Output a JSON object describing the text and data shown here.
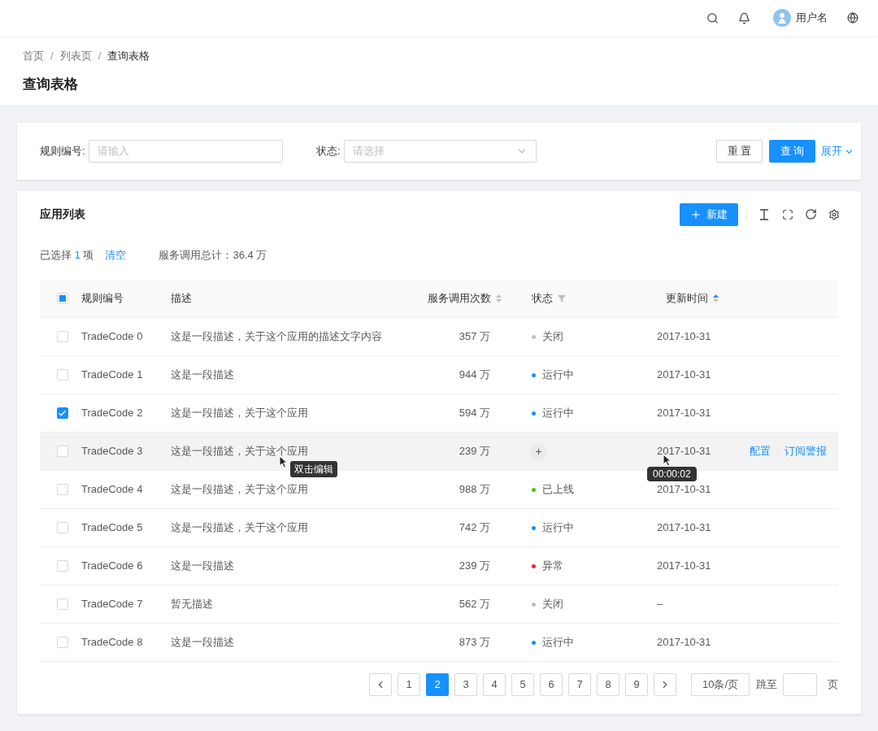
{
  "top_bar": {
    "user_name": "用户名"
  },
  "breadcrumb": [
    {
      "label": "首页",
      "current": false
    },
    {
      "separator": "/",
      "label": "列表页",
      "current": false
    },
    {
      "separator": "/",
      "label": "查询表格",
      "current": true
    }
  ],
  "page_title": "查询表格",
  "search_form": {
    "fields": [
      {
        "kind": "input",
        "label": "规则编号:",
        "placeholder": "请输入"
      },
      {
        "kind": "select",
        "label": "状态:",
        "placeholder": "请选择"
      }
    ],
    "reset_button": "重 置",
    "query_button": "查 询",
    "expand_link": "展开"
  },
  "table_card": {
    "title": "应用列表",
    "new_button": "新建",
    "selection_info": {
      "prefix": "已选择",
      "count": "1",
      "suffix": "项",
      "clear_link": "清空",
      "total": "服务调用总计：36.4 万"
    },
    "header_checkbox": {
      "indeterminate": true
    },
    "columns": [
      {
        "label": "规则编号",
        "kind": "plain"
      },
      {
        "label": "描述",
        "kind": "plain"
      },
      {
        "label": "服务调用次数",
        "kind": "sort"
      },
      {
        "label": "状态",
        "kind": "filter"
      },
      {
        "label": "更新时间",
        "kind": "sort_active"
      },
      {
        "kind": "actions"
      }
    ],
    "rows": [
      {
        "checked": false,
        "hovered": false,
        "code": "TradeCode 0",
        "description": "这是一段描述，关于这个应用的描述文字内容",
        "calls": "357 万",
        "status": {
          "label": "关闭",
          "color": "#bfbfbf"
        },
        "updated": "2017-10-31"
      },
      {
        "checked": false,
        "hovered": false,
        "code": "TradeCode 1",
        "description": "这是一段描述",
        "calls": "944 万",
        "status": {
          "label": "运行中",
          "color": "#1890ff"
        },
        "updated": "2017-10-31"
      },
      {
        "checked": true,
        "hovered": false,
        "code": "TradeCode 2",
        "description": "这是一段描述，关于这个应用",
        "calls": "594 万",
        "status": {
          "label": "运行中",
          "color": "#1890ff"
        },
        "updated": "2017-10-31"
      },
      {
        "checked": false,
        "hovered": true,
        "code": "TradeCode 3",
        "description": "这是一段描述，关于这个应用",
        "calls": "239 万",
        "status_add": "+",
        "updated": "2017-10-31",
        "actions": [
          "配置",
          "订阅警报"
        ],
        "description_tooltip": "双击编辑",
        "updated_tooltip": "00:00:02"
      },
      {
        "checked": false,
        "hovered": false,
        "code": "TradeCode 4",
        "description": "这是一段描述，关于这个应用",
        "calls": "988 万",
        "status": {
          "label": "已上线",
          "color": "#52c41a"
        },
        "updated": "2017-10-31"
      },
      {
        "checked": false,
        "hovered": false,
        "code": "TradeCode 5",
        "description": "这是一段描述，关于这个应用",
        "calls": "742 万",
        "status": {
          "label": "运行中",
          "color": "#1890ff"
        },
        "updated": "2017-10-31"
      },
      {
        "checked": false,
        "hovered": false,
        "code": "TradeCode 6",
        "description": "这是一段描述",
        "calls": "239 万",
        "status": {
          "label": "异常",
          "color": "#f5222d"
        },
        "updated": "2017-10-31"
      },
      {
        "checked": false,
        "hovered": false,
        "code": "TradeCode 7",
        "description": "暂无描述",
        "calls": "562 万",
        "status": {
          "label": "关闭",
          "color": "#bfbfbf"
        },
        "updated": "–"
      },
      {
        "checked": false,
        "hovered": false,
        "code": "TradeCode 8",
        "description": "这是一段描述",
        "calls": "873 万",
        "status": {
          "label": "运行中",
          "color": "#1890ff"
        },
        "updated": "2017-10-31"
      }
    ],
    "pagination": {
      "pages": [
        {
          "label": "1",
          "selected": false
        },
        {
          "label": "2",
          "selected": true
        },
        {
          "label": "3",
          "selected": false
        },
        {
          "label": "4",
          "selected": false
        },
        {
          "label": "5",
          "selected": false
        },
        {
          "label": "6",
          "selected": false
        },
        {
          "label": "7",
          "selected": false
        },
        {
          "label": "8",
          "selected": false
        },
        {
          "label": "9",
          "selected": false
        }
      ],
      "page_size": "10条/页",
      "jump_label": "跳至",
      "page_suffix": "页"
    }
  }
}
